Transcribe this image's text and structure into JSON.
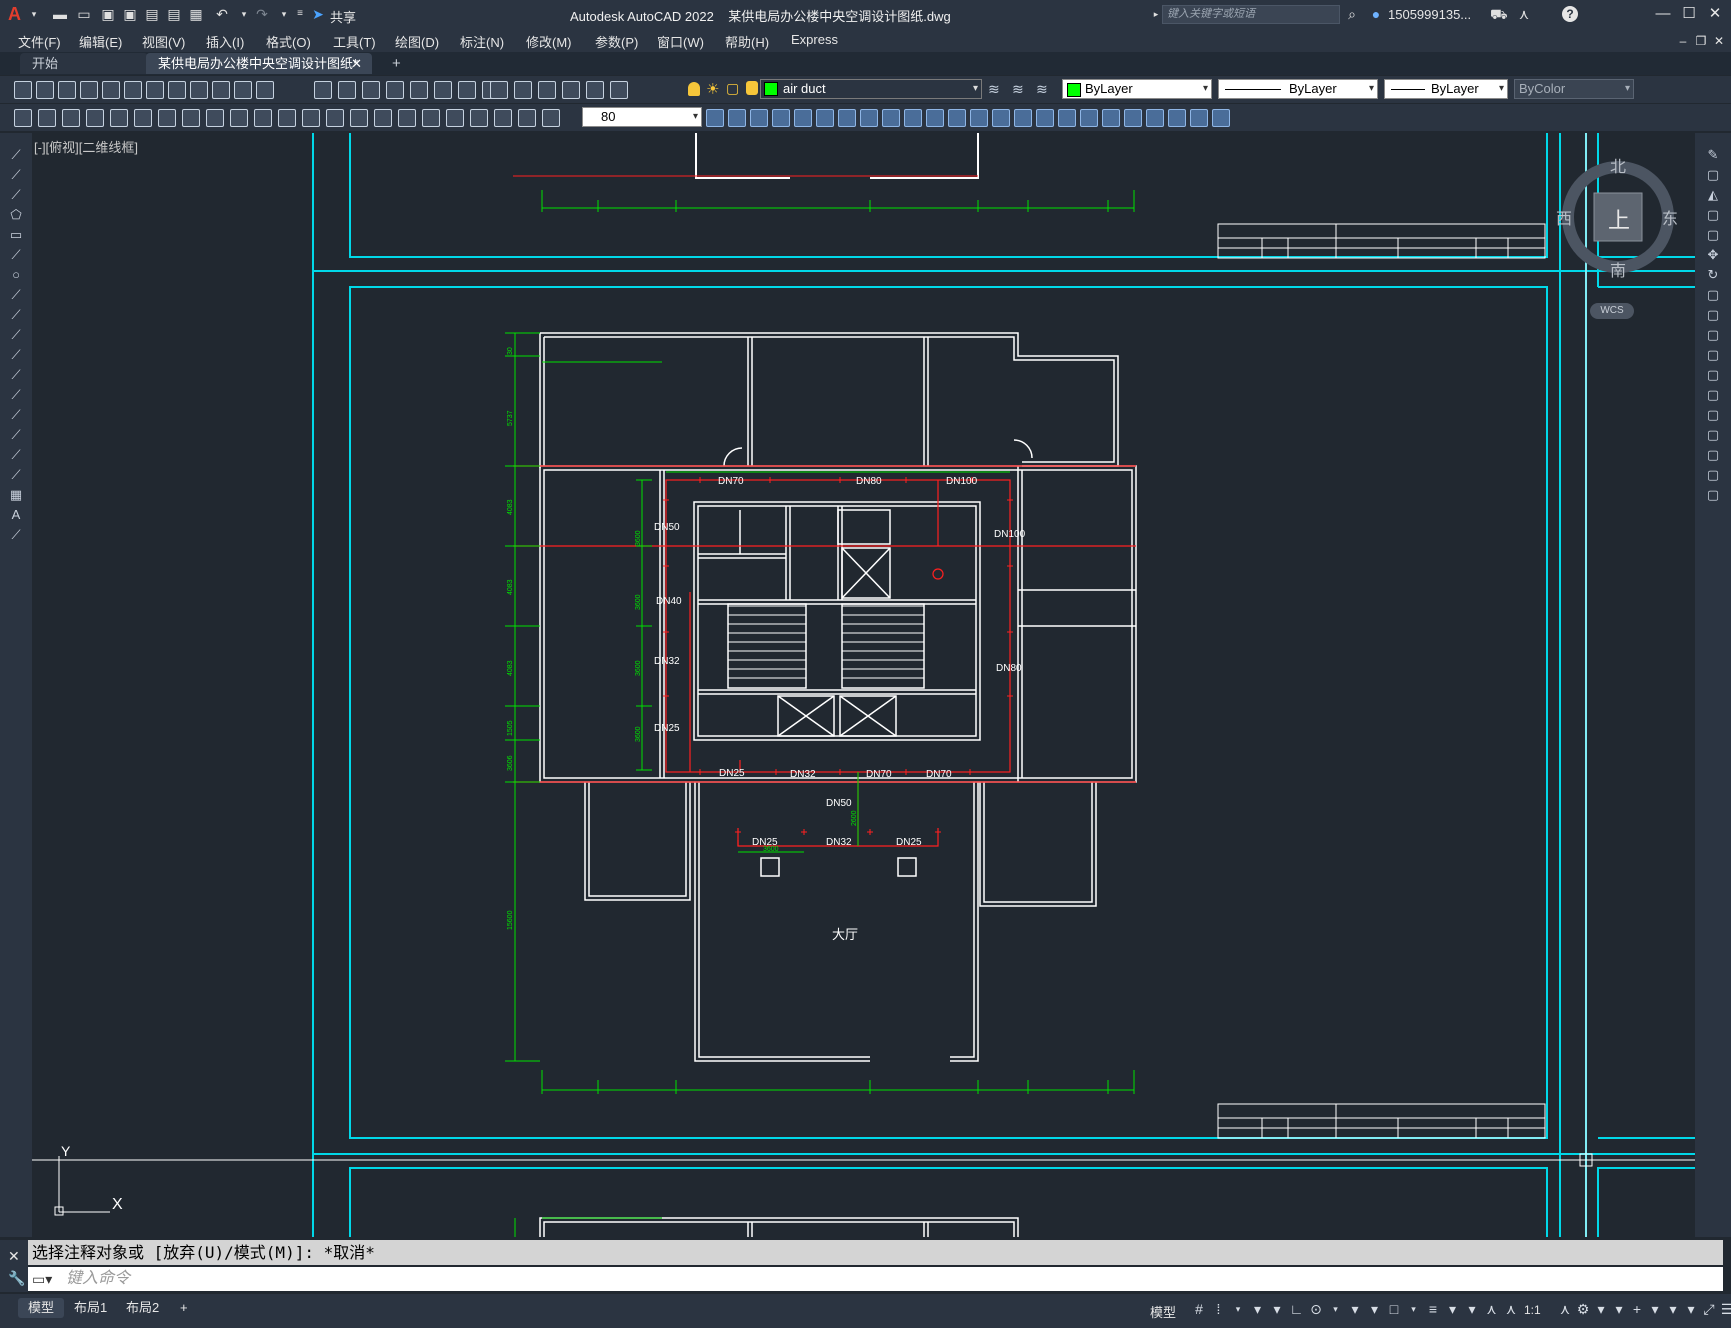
{
  "app": {
    "title": "Autodesk AutoCAD 2022",
    "filename": "某供电局办公楼中央空调设计图纸.dwg",
    "share_label": "共享",
    "search_placeholder": "键入关键字或短语",
    "user": "1505999135...",
    "help": "?"
  },
  "menu": [
    "文件(F)",
    "编辑(E)",
    "视图(V)",
    "插入(I)",
    "格式(O)",
    "工具(T)",
    "绘图(D)",
    "标注(N)",
    "修改(M)",
    "参数(P)",
    "窗口(W)",
    "帮助(H)",
    "Express"
  ],
  "tabs": {
    "start": "开始",
    "doc": "某供电局办公楼中央空调设计图纸*",
    "close": "✕",
    "add": "+"
  },
  "toolbar": {
    "layer": "air duct",
    "color": "ByLayer",
    "linetype": "ByLayer",
    "lineweight": "ByLayer",
    "plotstyle": "ByColor",
    "dim_value": "80"
  },
  "viewport": {
    "label": "[-][俯视][二维线框]",
    "compass": {
      "north": "北",
      "south": "南",
      "east": "东",
      "west": "西",
      "top": "上",
      "wcs": "WCS"
    },
    "ucs": {
      "x": "X",
      "y": "Y"
    }
  },
  "drawing": {
    "pipes_top": [
      "DN70",
      "DN80",
      "DN100"
    ],
    "pipes_left": [
      "DN50",
      "DN40",
      "DN32",
      "DN25"
    ],
    "pipes_right": [
      "DN100",
      "DN80"
    ],
    "pipes_bottom": [
      "DN25",
      "DN32",
      "DN70",
      "DN70"
    ],
    "pipes_lower": [
      "DN50",
      "DN25",
      "DN32",
      "DN25"
    ],
    "room_label": "大厅",
    "dims_vertical": [
      "5737",
      "4083",
      "4083",
      "4083",
      "1505",
      "3606",
      "15600",
      "30"
    ],
    "dims_inner": [
      "3600",
      "3600",
      "3600",
      "3600"
    ],
    "dims_lower": [
      "2600",
      "3600"
    ]
  },
  "command": {
    "history": "选择注释对象或 [放弃(U)/模式(M)]: *取消*",
    "placeholder": "键入命令"
  },
  "layouts": [
    "模型",
    "布局1",
    "布局2",
    "+"
  ],
  "status": {
    "model": "模型",
    "scale": "1:1"
  },
  "colors": {
    "background": "#212830",
    "frame": "#00d8e8",
    "wall": "#ffffff",
    "pipe": "#ff2020",
    "dimension": "#00e000",
    "accent": "#e23d2d"
  }
}
